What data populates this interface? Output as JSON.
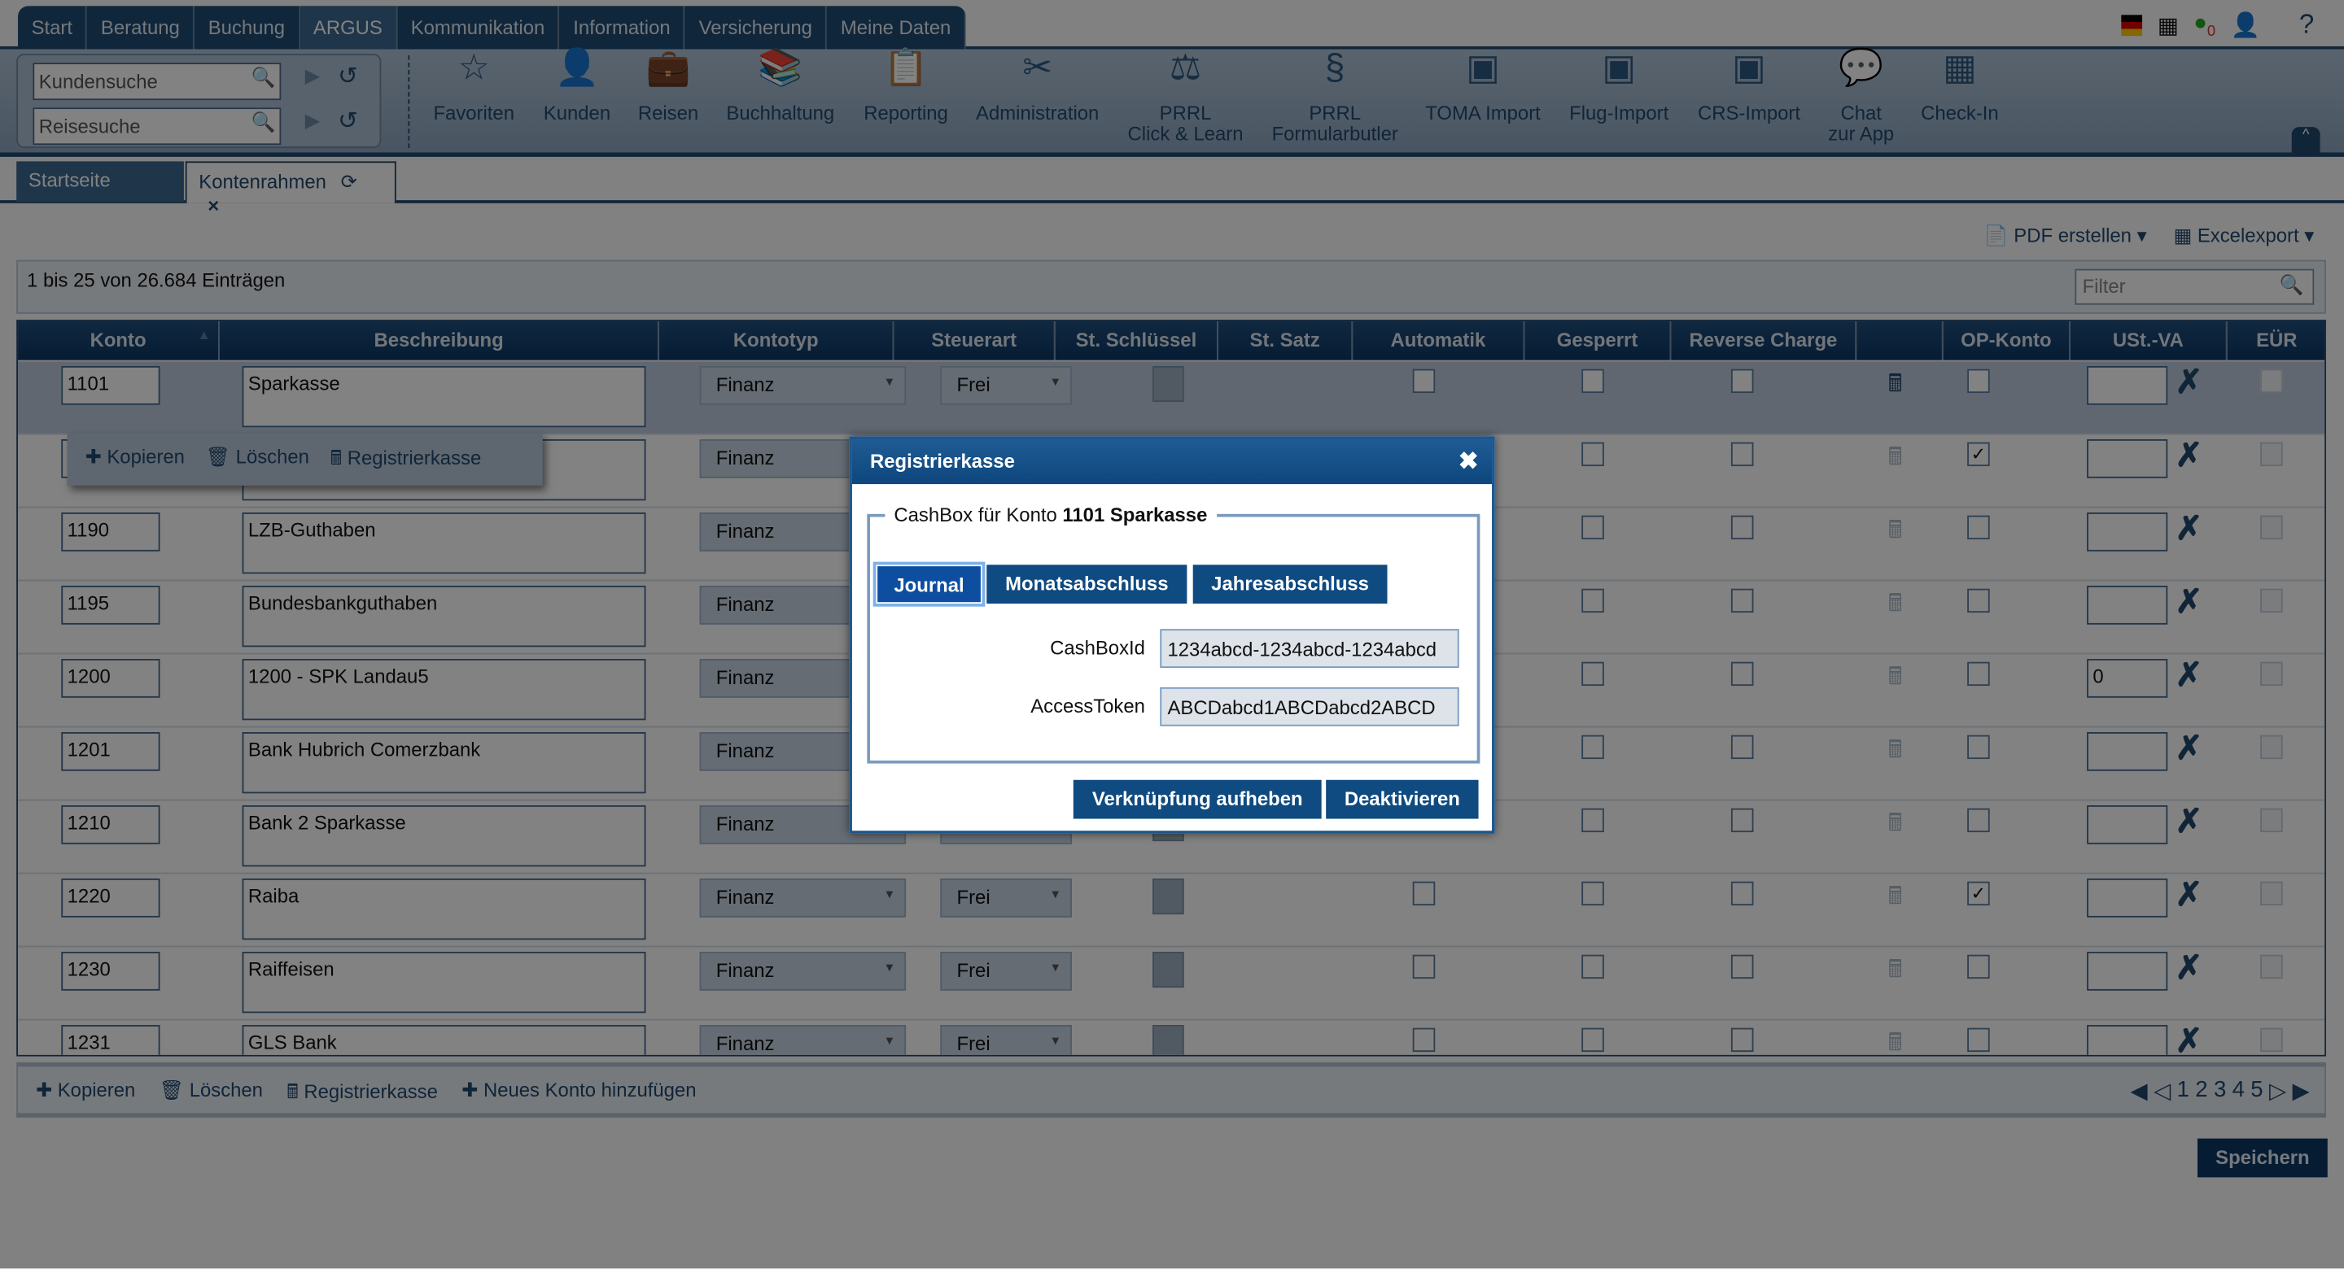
{
  "main_tabs": [
    {
      "label": "Start"
    },
    {
      "label": "Beratung"
    },
    {
      "label": "Buchung"
    },
    {
      "label": "ARGUS",
      "active": true
    },
    {
      "label": "Kommunikation"
    },
    {
      "label": "Information"
    },
    {
      "label": "Versicherung"
    },
    {
      "label": "Meine Daten"
    }
  ],
  "top_icons": {
    "whatsapp_count": "0",
    "help": "?"
  },
  "search": {
    "customer_placeholder": "Kundensuche",
    "trip_placeholder": "Reisesuche"
  },
  "ribbon": [
    {
      "label": "Favoriten",
      "icon": "star-icon",
      "glyph": "☆"
    },
    {
      "label": "Kunden",
      "icon": "person-icon",
      "glyph": "👤"
    },
    {
      "label": "Reisen",
      "icon": "suitcase-icon",
      "glyph": "💼"
    },
    {
      "label": "Buchhaltung",
      "icon": "binders-icon",
      "glyph": "📚"
    },
    {
      "label": "Reporting",
      "icon": "report-icon",
      "glyph": "📋"
    },
    {
      "label": "Administration",
      "icon": "tools-icon",
      "glyph": "✂"
    },
    {
      "label": "PRRL\nClick & Learn",
      "icon": "prrl-icon",
      "glyph": "⚖"
    },
    {
      "label": "PRRL\nFormularbutler",
      "icon": "paragraph-icon",
      "glyph": "§"
    },
    {
      "label": "TOMA Import",
      "icon": "import-icon",
      "glyph": "▣"
    },
    {
      "label": "Flug-Import",
      "icon": "import-icon",
      "glyph": "▣"
    },
    {
      "label": "CRS-Import",
      "icon": "import-icon",
      "glyph": "▣"
    },
    {
      "label": "Chat\nzur App",
      "icon": "chat-icon",
      "glyph": "💬"
    },
    {
      "label": "Check-In",
      "icon": "qr-code-icon",
      "glyph": "▦"
    }
  ],
  "subtabs": {
    "home": "Startseite",
    "current": "Kontenrahmen"
  },
  "toolbar": {
    "pdf": "PDF erstellen",
    "excel": "Excelexport"
  },
  "info": {
    "count_text": "1 bis 25 von 26.684 Einträgen",
    "filter_placeholder": "Filter"
  },
  "columns": [
    "Konto",
    "Beschreibung",
    "Kontotyp",
    "Steuerart",
    "St. Schlüssel",
    "St. Satz",
    "Automatik",
    "Gesperrt",
    "Reverse Charge",
    "",
    "OP-Konto",
    "USt.-VA",
    "EÜR"
  ],
  "rows": [
    {
      "konto": "1101",
      "beschreibung": "Sparkasse",
      "kontotyp": "Finanz",
      "steuerart": "Frei",
      "op": false,
      "ustva": "",
      "selected": true
    },
    {
      "konto": "",
      "beschreibung": "",
      "kontotyp": "Finanz",
      "steuerart": "Frei",
      "op": true,
      "ustva": ""
    },
    {
      "konto": "1190",
      "beschreibung": "LZB-Guthaben",
      "kontotyp": "Finanz",
      "steuerart": "Frei",
      "op": false,
      "ustva": ""
    },
    {
      "konto": "1195",
      "beschreibung": "Bundesbankguthaben",
      "kontotyp": "Finanz",
      "steuerart": "Frei",
      "op": false,
      "ustva": ""
    },
    {
      "konto": "1200",
      "beschreibung": "1200 - SPK Landau5",
      "kontotyp": "Finanz",
      "steuerart": "Frei",
      "op": false,
      "ustva": "0"
    },
    {
      "konto": "1201",
      "beschreibung": "Bank Hubrich Comerzbank",
      "kontotyp": "Finanz",
      "steuerart": "Frei",
      "op": false,
      "ustva": ""
    },
    {
      "konto": "1210",
      "beschreibung": "Bank 2 Sparkasse",
      "kontotyp": "Finanz",
      "steuerart": "Frei",
      "op": false,
      "ustva": ""
    },
    {
      "konto": "1220",
      "beschreibung": "Raiba",
      "kontotyp": "Finanz",
      "steuerart": "Frei",
      "op": true,
      "ustva": ""
    },
    {
      "konto": "1230",
      "beschreibung": "Raiffeisen",
      "kontotyp": "Finanz",
      "steuerart": "Frei",
      "op": false,
      "ustva": ""
    },
    {
      "konto": "1231",
      "beschreibung": "GLS Bank",
      "kontotyp": "Finanz",
      "steuerart": "Frei",
      "op": false,
      "ustva": ""
    }
  ],
  "context_menu": {
    "copy": "Kopieren",
    "delete": "Löschen",
    "register": "Registrierkasse"
  },
  "bottom": {
    "copy": "Kopieren",
    "delete": "Löschen",
    "register": "Registrierkasse",
    "add": "Neues Konto hinzufügen",
    "pages": [
      "1",
      "2",
      "3",
      "4",
      "5"
    ]
  },
  "save_label": "Speichern",
  "modal": {
    "title": "Registrierkasse",
    "legend_prefix": "CashBox für Konto ",
    "legend_bold": "1101 Sparkasse",
    "tabs": [
      "Journal",
      "Monatsabschluss",
      "Jahresabschluss"
    ],
    "cashbox_label": "CashBoxId",
    "cashbox_value": "1234abcd-1234abcd-1234abcd",
    "token_label": "AccessToken",
    "token_value": "ABCDabcd1ABCDabcd2ABCD",
    "unlink": "Verknüpfung aufheben",
    "deactivate": "Deaktivieren"
  },
  "colors": {
    "navy": "#0b3865",
    "accent": "#0f4a80",
    "selected_row": "#bccbdc"
  }
}
